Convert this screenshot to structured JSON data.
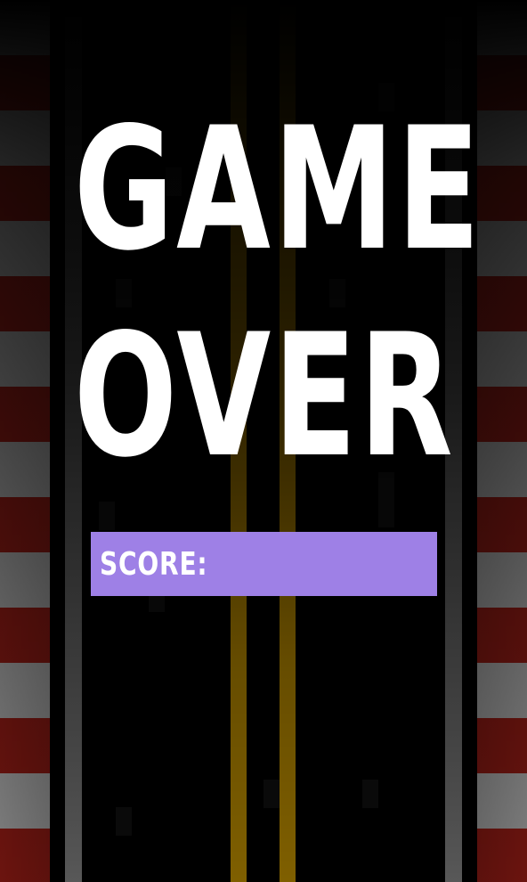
{
  "game_over": {
    "title_line_1": "GAME",
    "title_line_2": "OVER"
  },
  "score": {
    "label": "SCORE:",
    "value": ""
  },
  "colors": {
    "curb_red": "#d8281e",
    "curb_white": "#ffffff",
    "center_line_yellow": "#ffbf00",
    "edge_line_gray": "#b0b0b0",
    "score_bar_purple": "#9e80e6",
    "road": "#000000"
  }
}
